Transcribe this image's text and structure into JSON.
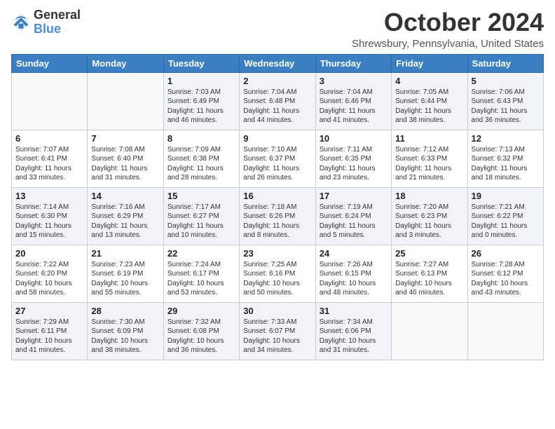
{
  "header": {
    "logo_line1": "General",
    "logo_line2": "Blue",
    "month": "October 2024",
    "location": "Shrewsbury, Pennsylvania, United States"
  },
  "weekdays": [
    "Sunday",
    "Monday",
    "Tuesday",
    "Wednesday",
    "Thursday",
    "Friday",
    "Saturday"
  ],
  "weeks": [
    [
      {
        "day": "",
        "sunrise": "",
        "sunset": "",
        "daylight": ""
      },
      {
        "day": "",
        "sunrise": "",
        "sunset": "",
        "daylight": ""
      },
      {
        "day": "1",
        "sunrise": "Sunrise: 7:03 AM",
        "sunset": "Sunset: 6:49 PM",
        "daylight": "Daylight: 11 hours and 46 minutes."
      },
      {
        "day": "2",
        "sunrise": "Sunrise: 7:04 AM",
        "sunset": "Sunset: 6:48 PM",
        "daylight": "Daylight: 11 hours and 44 minutes."
      },
      {
        "day": "3",
        "sunrise": "Sunrise: 7:04 AM",
        "sunset": "Sunset: 6:46 PM",
        "daylight": "Daylight: 11 hours and 41 minutes."
      },
      {
        "day": "4",
        "sunrise": "Sunrise: 7:05 AM",
        "sunset": "Sunset: 6:44 PM",
        "daylight": "Daylight: 11 hours and 38 minutes."
      },
      {
        "day": "5",
        "sunrise": "Sunrise: 7:06 AM",
        "sunset": "Sunset: 6:43 PM",
        "daylight": "Daylight: 11 hours and 36 minutes."
      }
    ],
    [
      {
        "day": "6",
        "sunrise": "Sunrise: 7:07 AM",
        "sunset": "Sunset: 6:41 PM",
        "daylight": "Daylight: 11 hours and 33 minutes."
      },
      {
        "day": "7",
        "sunrise": "Sunrise: 7:08 AM",
        "sunset": "Sunset: 6:40 PM",
        "daylight": "Daylight: 11 hours and 31 minutes."
      },
      {
        "day": "8",
        "sunrise": "Sunrise: 7:09 AM",
        "sunset": "Sunset: 6:38 PM",
        "daylight": "Daylight: 11 hours and 28 minutes."
      },
      {
        "day": "9",
        "sunrise": "Sunrise: 7:10 AM",
        "sunset": "Sunset: 6:37 PM",
        "daylight": "Daylight: 11 hours and 26 minutes."
      },
      {
        "day": "10",
        "sunrise": "Sunrise: 7:11 AM",
        "sunset": "Sunset: 6:35 PM",
        "daylight": "Daylight: 11 hours and 23 minutes."
      },
      {
        "day": "11",
        "sunrise": "Sunrise: 7:12 AM",
        "sunset": "Sunset: 6:33 PM",
        "daylight": "Daylight: 11 hours and 21 minutes."
      },
      {
        "day": "12",
        "sunrise": "Sunrise: 7:13 AM",
        "sunset": "Sunset: 6:32 PM",
        "daylight": "Daylight: 11 hours and 18 minutes."
      }
    ],
    [
      {
        "day": "13",
        "sunrise": "Sunrise: 7:14 AM",
        "sunset": "Sunset: 6:30 PM",
        "daylight": "Daylight: 11 hours and 15 minutes."
      },
      {
        "day": "14",
        "sunrise": "Sunrise: 7:16 AM",
        "sunset": "Sunset: 6:29 PM",
        "daylight": "Daylight: 11 hours and 13 minutes."
      },
      {
        "day": "15",
        "sunrise": "Sunrise: 7:17 AM",
        "sunset": "Sunset: 6:27 PM",
        "daylight": "Daylight: 11 hours and 10 minutes."
      },
      {
        "day": "16",
        "sunrise": "Sunrise: 7:18 AM",
        "sunset": "Sunset: 6:26 PM",
        "daylight": "Daylight: 11 hours and 8 minutes."
      },
      {
        "day": "17",
        "sunrise": "Sunrise: 7:19 AM",
        "sunset": "Sunset: 6:24 PM",
        "daylight": "Daylight: 11 hours and 5 minutes."
      },
      {
        "day": "18",
        "sunrise": "Sunrise: 7:20 AM",
        "sunset": "Sunset: 6:23 PM",
        "daylight": "Daylight: 11 hours and 3 minutes."
      },
      {
        "day": "19",
        "sunrise": "Sunrise: 7:21 AM",
        "sunset": "Sunset: 6:22 PM",
        "daylight": "Daylight: 11 hours and 0 minutes."
      }
    ],
    [
      {
        "day": "20",
        "sunrise": "Sunrise: 7:22 AM",
        "sunset": "Sunset: 6:20 PM",
        "daylight": "Daylight: 10 hours and 58 minutes."
      },
      {
        "day": "21",
        "sunrise": "Sunrise: 7:23 AM",
        "sunset": "Sunset: 6:19 PM",
        "daylight": "Daylight: 10 hours and 55 minutes."
      },
      {
        "day": "22",
        "sunrise": "Sunrise: 7:24 AM",
        "sunset": "Sunset: 6:17 PM",
        "daylight": "Daylight: 10 hours and 53 minutes."
      },
      {
        "day": "23",
        "sunrise": "Sunrise: 7:25 AM",
        "sunset": "Sunset: 6:16 PM",
        "daylight": "Daylight: 10 hours and 50 minutes."
      },
      {
        "day": "24",
        "sunrise": "Sunrise: 7:26 AM",
        "sunset": "Sunset: 6:15 PM",
        "daylight": "Daylight: 10 hours and 48 minutes."
      },
      {
        "day": "25",
        "sunrise": "Sunrise: 7:27 AM",
        "sunset": "Sunset: 6:13 PM",
        "daylight": "Daylight: 10 hours and 46 minutes."
      },
      {
        "day": "26",
        "sunrise": "Sunrise: 7:28 AM",
        "sunset": "Sunset: 6:12 PM",
        "daylight": "Daylight: 10 hours and 43 minutes."
      }
    ],
    [
      {
        "day": "27",
        "sunrise": "Sunrise: 7:29 AM",
        "sunset": "Sunset: 6:11 PM",
        "daylight": "Daylight: 10 hours and 41 minutes."
      },
      {
        "day": "28",
        "sunrise": "Sunrise: 7:30 AM",
        "sunset": "Sunset: 6:09 PM",
        "daylight": "Daylight: 10 hours and 38 minutes."
      },
      {
        "day": "29",
        "sunrise": "Sunrise: 7:32 AM",
        "sunset": "Sunset: 6:08 PM",
        "daylight": "Daylight: 10 hours and 36 minutes."
      },
      {
        "day": "30",
        "sunrise": "Sunrise: 7:33 AM",
        "sunset": "Sunset: 6:07 PM",
        "daylight": "Daylight: 10 hours and 34 minutes."
      },
      {
        "day": "31",
        "sunrise": "Sunrise: 7:34 AM",
        "sunset": "Sunset: 6:06 PM",
        "daylight": "Daylight: 10 hours and 31 minutes."
      },
      {
        "day": "",
        "sunrise": "",
        "sunset": "",
        "daylight": ""
      },
      {
        "day": "",
        "sunrise": "",
        "sunset": "",
        "daylight": ""
      }
    ]
  ]
}
